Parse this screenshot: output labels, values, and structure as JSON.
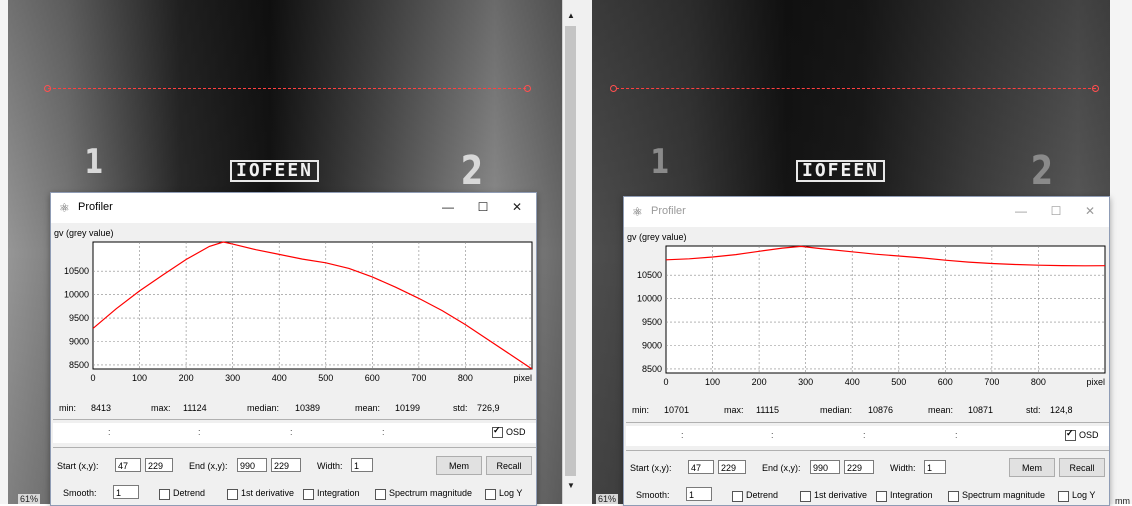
{
  "left_pane": {
    "zoom_label": "61%",
    "image_labels": {
      "num1": "1",
      "num2": "2",
      "text": "IOFEEN"
    }
  },
  "right_pane": {
    "zoom_label": "61%",
    "corner_fragment": "mm",
    "image_labels": {
      "num1": "1",
      "num2": "2",
      "text": "IOFEEN"
    }
  },
  "scrollbar": {
    "up_arrow": "▲",
    "down_arrow": "▼"
  },
  "profilers": [
    {
      "title": "Profiler",
      "active": true,
      "window_icon": "⚛",
      "buttons": {
        "minimize": "—",
        "maximize": "☐",
        "close": "✕"
      },
      "ylabel": "gv (grey value)",
      "yticks": [
        "10500",
        "10000",
        "9500",
        "9000",
        "8500"
      ],
      "xticks": [
        "0",
        "100",
        "200",
        "300",
        "400",
        "500",
        "600",
        "700",
        "800"
      ],
      "xunit": "pixel",
      "stats": {
        "min_label": "min:",
        "min": "8413",
        "max_label": "max:",
        "max": "11124",
        "median_label": "median:",
        "median": "10389",
        "mean_label": "mean:",
        "mean": "10199",
        "std_label": "std:",
        "std": "726,9"
      },
      "osd": {
        "label": "OSD",
        "checked": true,
        "placeholders": [
          ":",
          ":",
          ":",
          ":"
        ]
      },
      "controls": {
        "start_label": "Start (x,y):",
        "start_x": "47",
        "start_y": "229",
        "end_label": "End (x,y):",
        "end_x": "990",
        "end_y": "229",
        "width_label": "Width:",
        "width": "1",
        "mem": "Mem",
        "recall": "Recall",
        "smooth_label": "Smooth:",
        "smooth": "1",
        "options": [
          "Detrend",
          "1st derivative",
          "Integration",
          "Spectrum magnitude",
          "Log Y"
        ]
      }
    },
    {
      "title": "Profiler",
      "active": false,
      "window_icon": "⚛",
      "buttons": {
        "minimize": "—",
        "maximize": "☐",
        "close": "✕"
      },
      "ylabel": "gv (grey value)",
      "yticks": [
        "10500",
        "10000",
        "9500",
        "9000",
        "8500"
      ],
      "xticks": [
        "0",
        "100",
        "200",
        "300",
        "400",
        "500",
        "600",
        "700",
        "800"
      ],
      "xunit": "pixel",
      "stats": {
        "min_label": "min:",
        "min": "10701",
        "max_label": "max:",
        "max": "11115",
        "median_label": "median:",
        "median": "10876",
        "mean_label": "mean:",
        "mean": "10871",
        "std_label": "std:",
        "std": "124,8"
      },
      "osd": {
        "label": "OSD",
        "checked": true,
        "placeholders": [
          ":",
          ":",
          ":",
          ":"
        ]
      },
      "controls": {
        "start_label": "Start (x,y):",
        "start_x": "47",
        "start_y": "229",
        "end_label": "End (x,y):",
        "end_x": "990",
        "end_y": "229",
        "width_label": "Width:",
        "width": "1",
        "mem": "Mem",
        "recall": "Recall",
        "smooth_label": "Smooth:",
        "smooth": "1",
        "options": [
          "Detrend",
          "1st derivative",
          "Integration",
          "Spectrum magnitude",
          "Log Y"
        ]
      }
    }
  ],
  "chart_data": [
    {
      "type": "line",
      "ylabel": "gv (grey value)",
      "xlabel": "pixel",
      "xlim": [
        0,
        943
      ],
      "ylim": [
        8413,
        11124
      ],
      "grid": true,
      "series": [
        {
          "color": "#ff0000",
          "x": [
            0,
            50,
            100,
            150,
            200,
            250,
            280,
            300,
            350,
            400,
            450,
            500,
            550,
            600,
            650,
            700,
            750,
            800,
            850,
            900,
            943
          ],
          "y": [
            9280,
            9700,
            10080,
            10420,
            10750,
            11030,
            11124,
            11080,
            10960,
            10860,
            10760,
            10680,
            10560,
            10380,
            10160,
            9920,
            9660,
            9360,
            9030,
            8700,
            8413
          ]
        }
      ]
    },
    {
      "type": "line",
      "ylabel": "gv (grey value)",
      "xlabel": "pixel",
      "xlim": [
        0,
        943
      ],
      "ylim": [
        8413,
        11124
      ],
      "grid": true,
      "series": [
        {
          "color": "#ff0000",
          "x": [
            0,
            50,
            100,
            150,
            200,
            250,
            290,
            330,
            400,
            450,
            500,
            550,
            600,
            650,
            700,
            750,
            800,
            850,
            900,
            943
          ],
          "y": [
            10830,
            10850,
            10890,
            10940,
            11010,
            11080,
            11115,
            11070,
            11000,
            10950,
            10910,
            10870,
            10820,
            10780,
            10750,
            10730,
            10715,
            10705,
            10701,
            10703
          ]
        }
      ]
    }
  ]
}
